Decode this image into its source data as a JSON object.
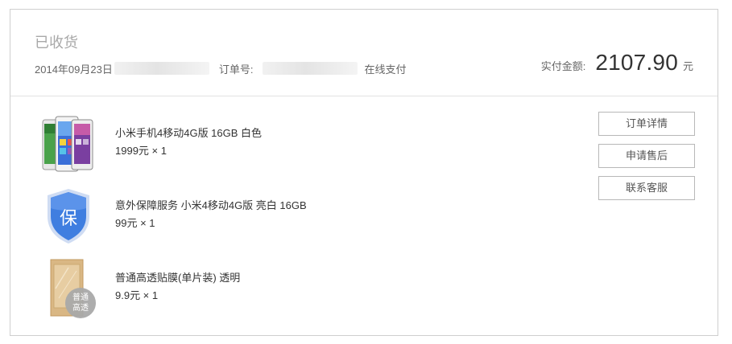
{
  "order": {
    "status": "已收货",
    "date": "2014年09月23日",
    "order_no_label": "订单号:",
    "payment_method": "在线支付",
    "total_label": "实付金额:",
    "total_amount": "2107.90",
    "currency": "元"
  },
  "items": [
    {
      "name": "小米手机4移动4G版 16GB 白色",
      "price": "1999元 × 1",
      "icon": "phone-product-icon"
    },
    {
      "name": "意外保障服务 小米4移动4G版 亮白 16GB",
      "price": "99元 × 1",
      "icon": "insurance-shield-icon",
      "badge_text": "保"
    },
    {
      "name": "普通高透贴膜(单片装) 透明",
      "price": "9.9元 × 1",
      "icon": "screen-film-icon",
      "badge_text": "普通\n高透"
    }
  ],
  "actions": {
    "details_label": "订单详情",
    "after_sales_label": "申请售后",
    "contact_label": "联系客服"
  },
  "colors": {
    "border": "#cfcfcf",
    "shield_blue": "#3f7ee0",
    "film_tan": "#d9b784",
    "badge_gray": "#a9a9a9"
  }
}
